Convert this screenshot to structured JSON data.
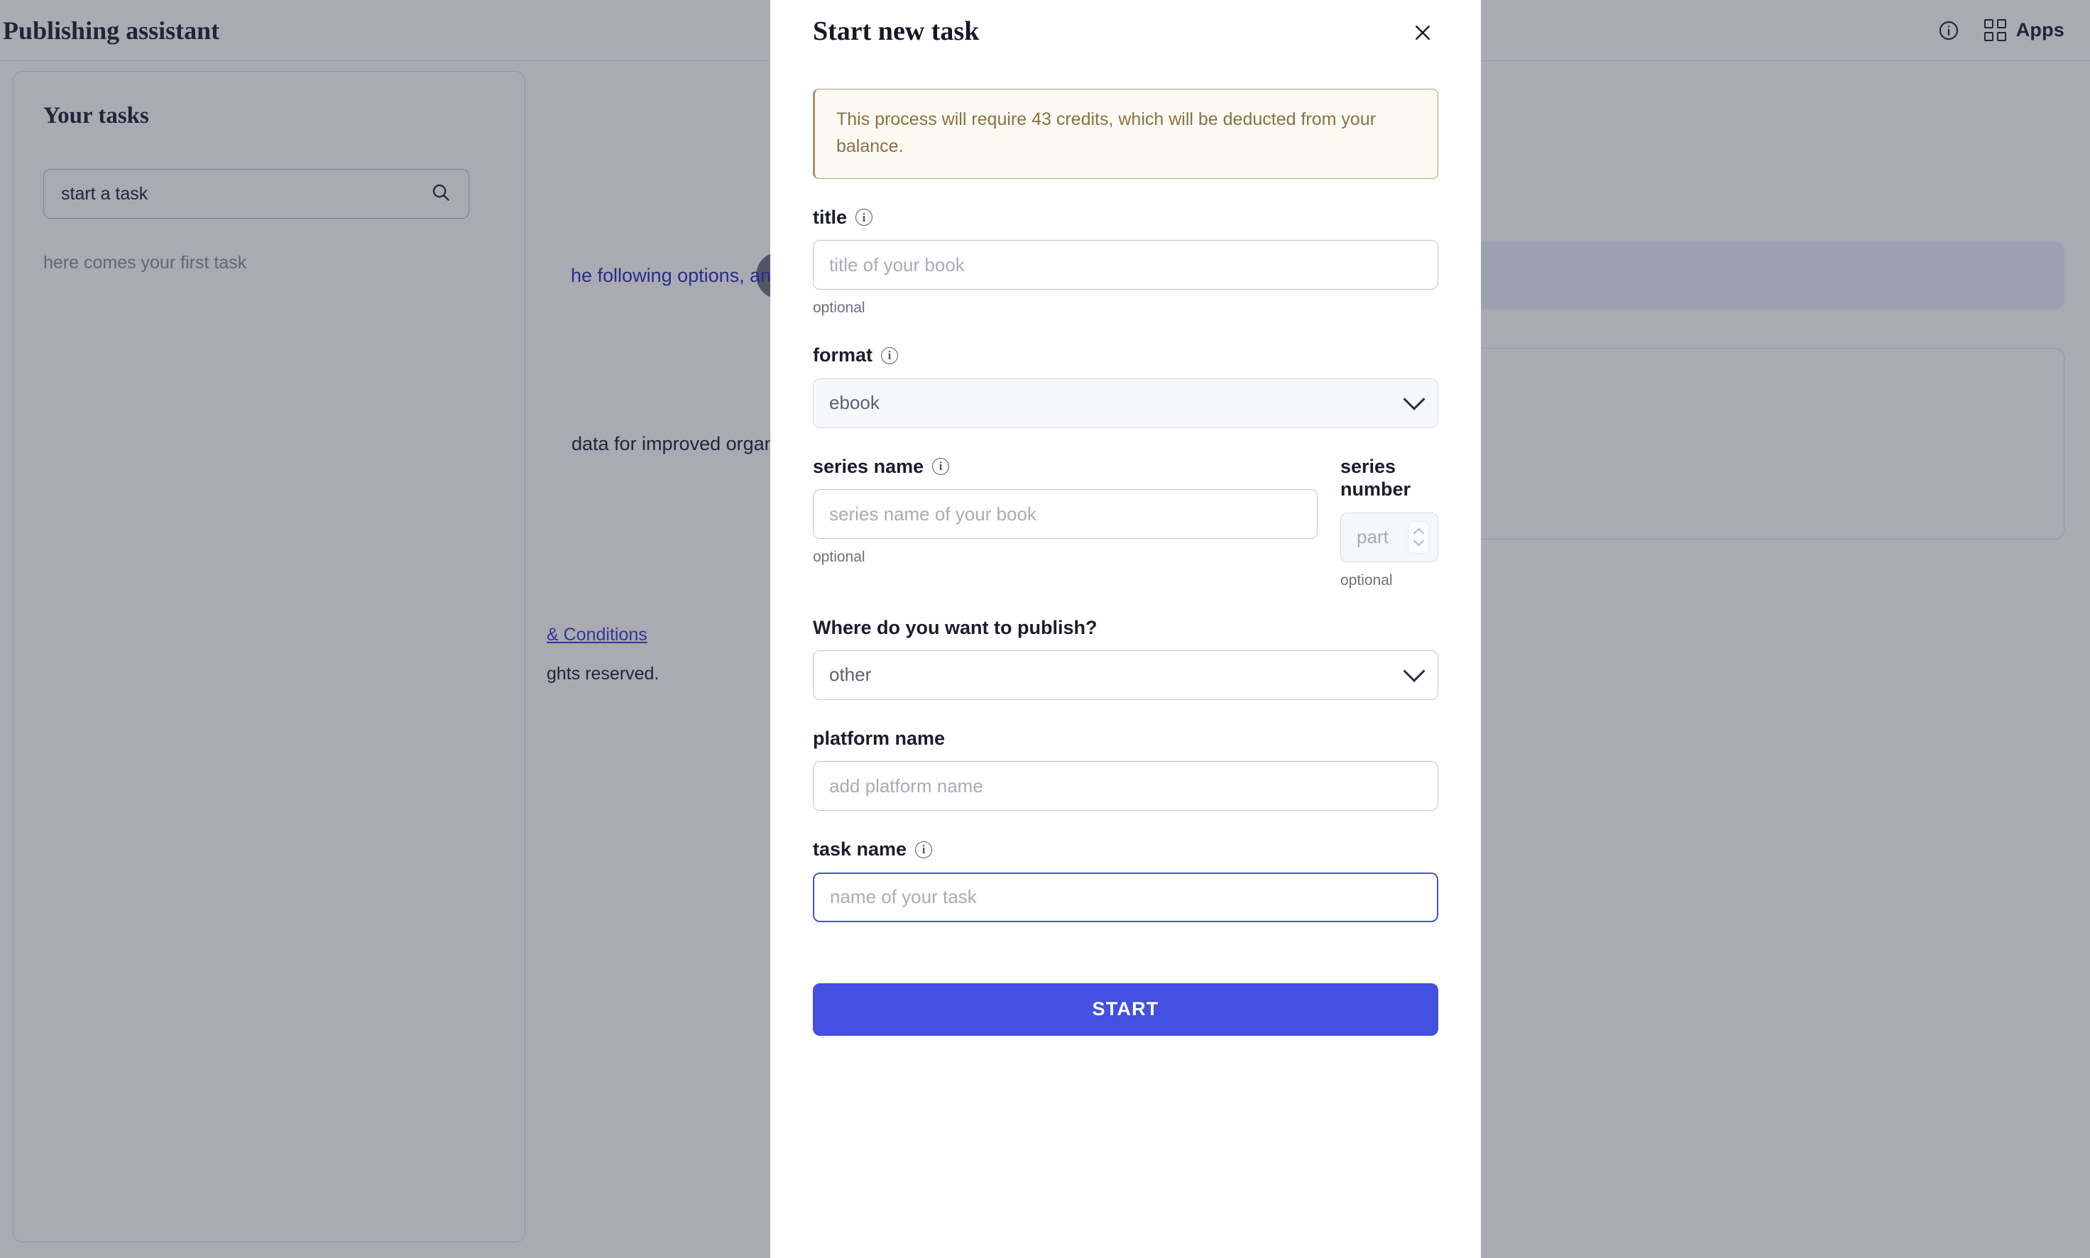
{
  "topbar": {
    "title": "Publishing assistant",
    "info_icon": "info-circle-icon",
    "apps_icon": "grid-apps-icon",
    "apps_label": "Apps"
  },
  "tasks_panel": {
    "heading": "Your tasks",
    "search_value": "start a task",
    "search_icon": "search-icon",
    "empty_text": "here comes your first task"
  },
  "background": {
    "assistant_message": "he following options, and I'll assist you further.",
    "info_card_text": "data for improved organic visibility and sales in stores.",
    "footer_link": "& Conditions",
    "footer_copyright": "ghts reserved."
  },
  "modal": {
    "title": "Start new task",
    "close_icon": "close-icon",
    "alert": {
      "text": "This process will require 43 credits, which will be deducted from your balance.",
      "credits": 43,
      "accent_color": "#a98f6b",
      "bg_color": "#fdfaf3"
    },
    "fields": {
      "title": {
        "label": "title",
        "info_icon": "info-circle-icon",
        "placeholder": "title of your book",
        "value": "",
        "hint": "optional"
      },
      "format": {
        "label": "format",
        "info_icon": "info-circle-icon",
        "value": "ebook",
        "chevron_icon": "chevron-down-icon"
      },
      "series_name": {
        "label": "series name",
        "info_icon": "info-circle-icon",
        "placeholder": "series name of your book",
        "value": "",
        "hint": "optional"
      },
      "series_number": {
        "label": "series number",
        "placeholder": "part",
        "value": "",
        "hint": "optional",
        "stepper_icon": "stepper-up-down-icon"
      },
      "publish_where": {
        "label": "Where do you want to publish?",
        "value": "other",
        "chevron_icon": "chevron-down-icon"
      },
      "platform_name": {
        "label": "platform name",
        "placeholder": "add platform name",
        "value": ""
      },
      "task_name": {
        "label": "task name",
        "info_icon": "info-circle-icon",
        "placeholder": "name of your task",
        "value": "",
        "focused": true
      }
    },
    "submit_label": "START",
    "accent_color": "#4450df"
  }
}
